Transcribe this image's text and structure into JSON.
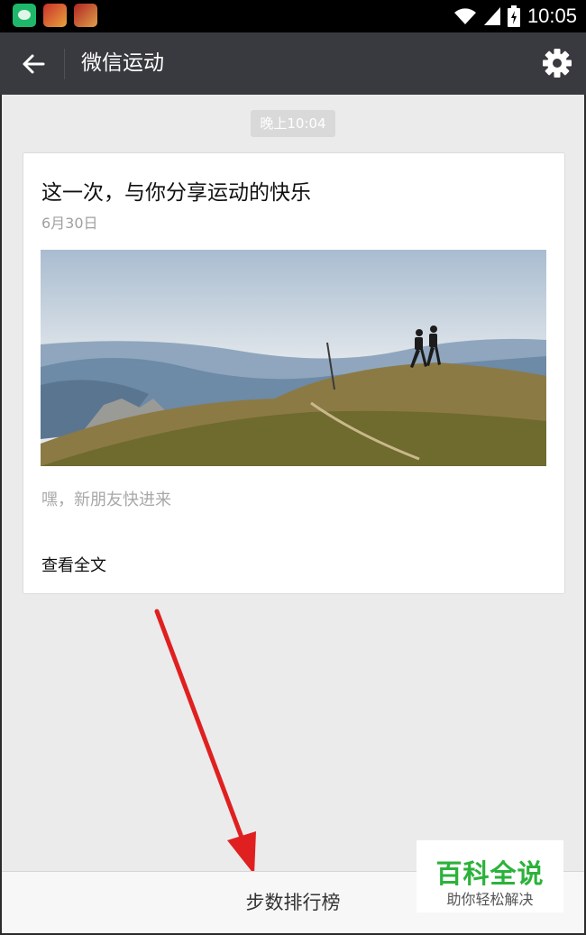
{
  "status_bar": {
    "time": "10:05",
    "icons": [
      "wechat-app-icon",
      "game-app-icon",
      "game-app-icon",
      "wifi-icon",
      "signal-icon",
      "battery-icon"
    ]
  },
  "navbar": {
    "title": "微信运动",
    "back_icon": "arrow-left-icon",
    "settings_icon": "gear-icon"
  },
  "chat": {
    "timestamp": "晚上10:04",
    "card": {
      "title": "这一次，与你分享运动的快乐",
      "date": "6月30日",
      "description": "嘿，新朋友快进来",
      "read_more": "查看全文"
    }
  },
  "bottom_bar": {
    "label": "步数排行榜"
  },
  "watermark": {
    "main": "百科全说",
    "sub": "助你轻松解决"
  },
  "colors": {
    "navbar": "#393a3f",
    "background": "#ebebeb",
    "annotation_arrow": "#e02020",
    "watermark_green": "#2bb23a"
  }
}
